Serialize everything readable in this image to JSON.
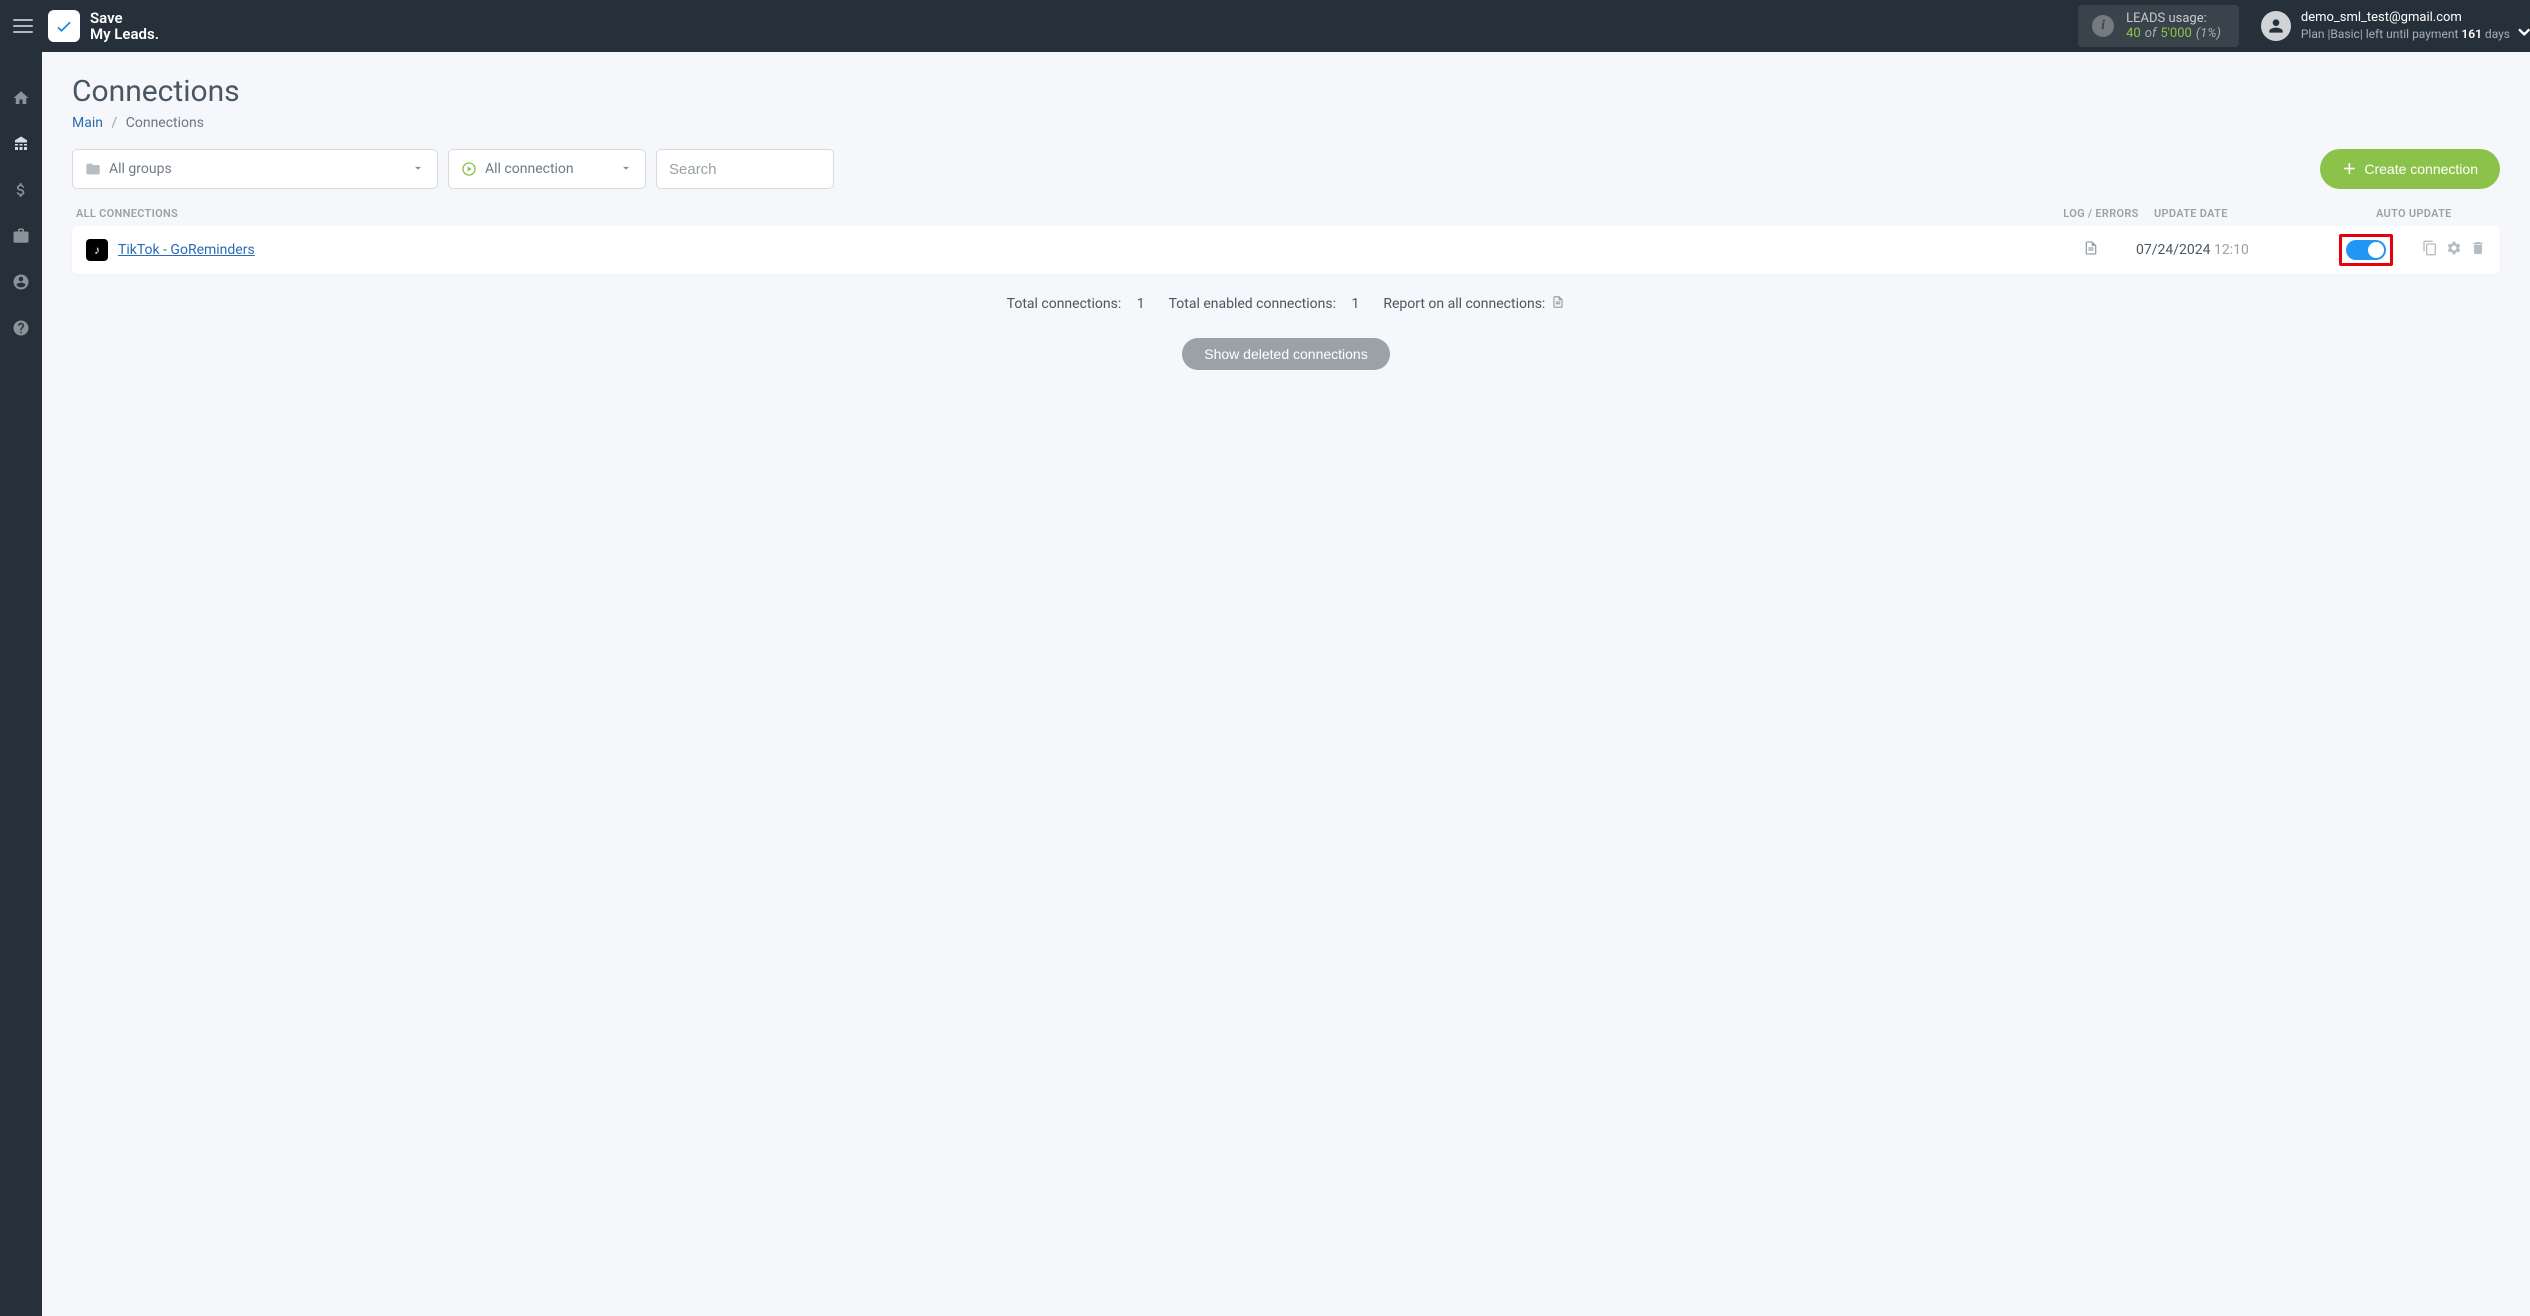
{
  "brand": {
    "line1": "Save",
    "line2": "My Leads."
  },
  "leads_usage": {
    "label": "LEADS usage:",
    "used": "40",
    "of": "of",
    "total": "5'000",
    "pct": "(1%)"
  },
  "account": {
    "email": "demo_sml_test@gmail.com",
    "plan_prefix": "Plan |",
    "plan_name": "Basic",
    "plan_mid": "| left until payment",
    "days": "161",
    "days_suffix": "days"
  },
  "page": {
    "title": "Connections",
    "breadcrumb_main": "Main",
    "breadcrumb_current": "Connections"
  },
  "filters": {
    "groups": "All groups",
    "status": "All connection",
    "search_placeholder": "Search"
  },
  "create_label": "Create connection",
  "table": {
    "col_name": "ALL CONNECTIONS",
    "col_log": "LOG / ERRORS",
    "col_date": "UPDATE DATE",
    "col_auto": "AUTO UPDATE"
  },
  "rows": [
    {
      "icon_letter": "♪",
      "name": "TikTok - GoReminders",
      "date": "07/24/2024",
      "time": "12:10",
      "auto": true
    }
  ],
  "summary": {
    "total_label": "Total connections:",
    "total_val": "1",
    "enabled_label": "Total enabled connections:",
    "enabled_val": "1",
    "report_label": "Report on all connections:"
  },
  "show_deleted": "Show deleted connections"
}
